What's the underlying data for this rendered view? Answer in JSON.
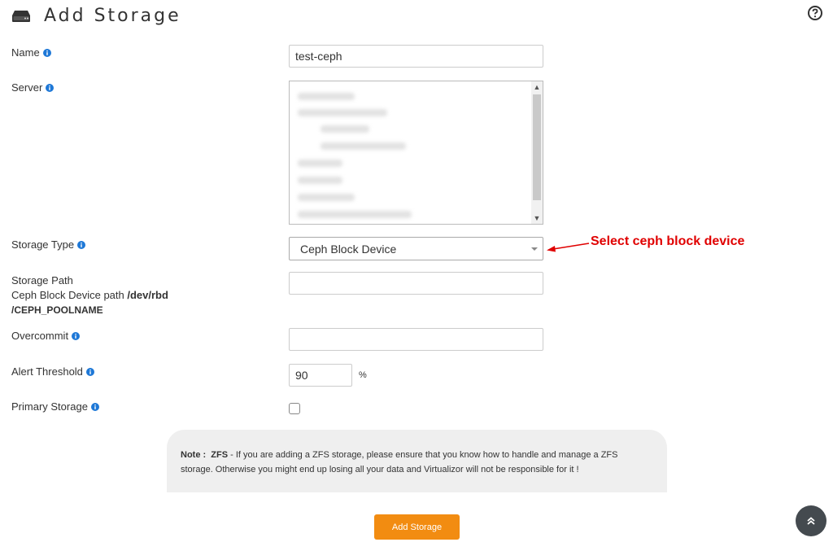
{
  "header": {
    "title": "Add Storage",
    "icon": "hard-drive-icon",
    "help_icon": "help-circle-icon"
  },
  "form": {
    "name": {
      "label": "Name",
      "value": "test-ceph"
    },
    "server": {
      "label": "Server"
    },
    "storage_type": {
      "label": "Storage Type",
      "selected": "Ceph Block Device"
    },
    "storage_path": {
      "label": "Storage Path",
      "hint_prefix": "Ceph Block Device path",
      "hint_path_1": "/dev/rbd",
      "hint_path_2": "/CEPH_POOLNAME",
      "value": ""
    },
    "overcommit": {
      "label": "Overcommit",
      "value": ""
    },
    "alert_threshold": {
      "label": "Alert Threshold",
      "value": "90",
      "unit": "%"
    },
    "primary_storage": {
      "label": "Primary Storage",
      "checked": false
    }
  },
  "annotation": {
    "text": "Select ceph block device",
    "color": "#e00000"
  },
  "note": {
    "prefix": "Note :",
    "keyword": "ZFS",
    "text": " - If you are adding a ZFS storage, please ensure that you know how to handle and manage a ZFS storage. Otherwise you might end up losing all your data and Virtualizor will not be responsible for it !"
  },
  "submit": {
    "label": "Add Storage",
    "color": "#f28c11"
  },
  "scroll_top_icon": "double-chevron-up-icon"
}
